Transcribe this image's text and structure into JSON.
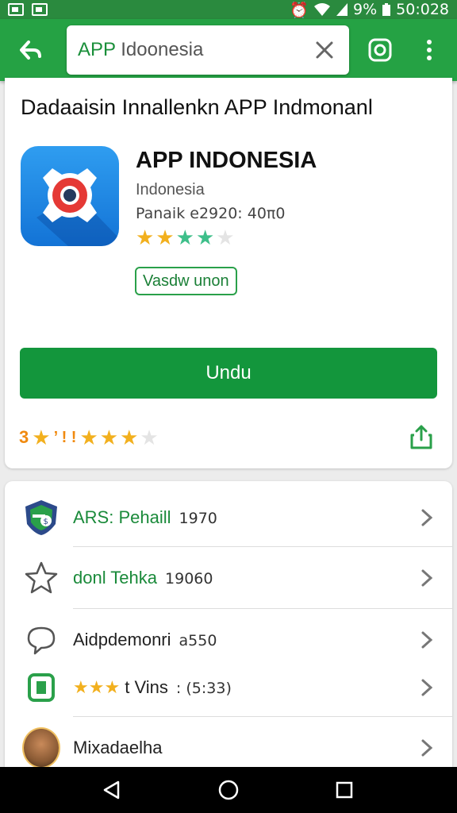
{
  "status_bar": {
    "battery": "9%",
    "time": "50:028"
  },
  "search": {
    "query_prefix": "APP",
    "query_rest": " Idoonesia"
  },
  "promo": {
    "title": "Dadaaisin Innallenkn APP Indmonanl"
  },
  "app": {
    "name": "APP INDONESIA",
    "developer": "Indonesia",
    "meta": "Panaik e2920: 40π0",
    "rating_stars": 3.5,
    "tag": "Vasdw unon",
    "install_label": "Undu",
    "rating_number": "3",
    "rating_sep": "’ ! !"
  },
  "colors": {
    "brand_green": "#25a244",
    "button_green": "#13963c",
    "star_gold": "#f2b01e",
    "star_teal": "#3ebf8a",
    "rating_orange": "#f08a10",
    "app_icon_blue": "#1e88e5"
  },
  "list": {
    "items": [
      {
        "icon": "shield-icon",
        "label": "ARS: Pehaill",
        "value": "1970"
      },
      {
        "icon": "star-outline-icon",
        "label": "donl Tehka",
        "value": "19060"
      },
      {
        "icon": "chat-bubble-icon",
        "label": "Aidpdemonri",
        "value": "a550"
      },
      {
        "icon": "trash-icon",
        "label": "t Vins",
        "value": ": (5:33)",
        "label_prefix": "★★★"
      },
      {
        "icon": "avatar",
        "label": "Mixadaelha",
        "value": ""
      }
    ]
  },
  "icons": {
    "back": "back-arrow-icon",
    "clear": "clear-icon",
    "camera": "camera-icon",
    "more": "more-vertical-icon",
    "share": "share-icon",
    "chevron": "chevron-right-icon",
    "nav": [
      "nav-back-icon",
      "nav-home-icon",
      "nav-recents-icon"
    ]
  }
}
